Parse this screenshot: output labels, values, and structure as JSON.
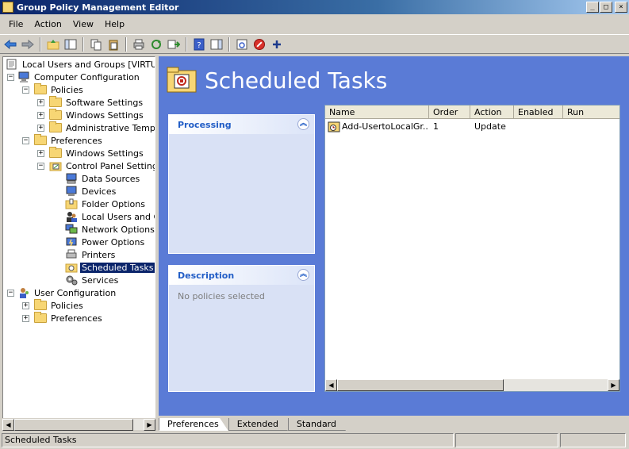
{
  "window": {
    "title": "Group Policy Management Editor"
  },
  "menu": {
    "items": [
      "File",
      "Action",
      "View",
      "Help"
    ]
  },
  "tree": {
    "root": "Local Users and Groups [VIRTUALA",
    "computer_config": "Computer Configuration",
    "policies": "Policies",
    "software_settings": "Software Settings",
    "windows_settings": "Windows Settings",
    "admin_templates": "Administrative Templat",
    "preferences": "Preferences",
    "pref_windows_settings": "Windows Settings",
    "control_panel_settings": "Control Panel Settings",
    "data_sources": "Data Sources",
    "devices": "Devices",
    "folder_options": "Folder Options",
    "local_users": "Local Users and Gr",
    "network_options": "Network Options",
    "power_options": "Power Options",
    "printers": "Printers",
    "scheduled_tasks": "Scheduled Tasks",
    "services": "Services",
    "user_config": "User Configuration",
    "user_policies": "Policies",
    "user_preferences": "Preferences"
  },
  "header": {
    "title": "Scheduled Tasks"
  },
  "processing_panel": {
    "title": "Processing"
  },
  "description_panel": {
    "title": "Description",
    "text": "No policies selected"
  },
  "list": {
    "columns": [
      "Name",
      "Order",
      "Action",
      "Enabled",
      "Run"
    ],
    "rows": [
      {
        "name": "Add-UsertoLocalGr...",
        "order": "1",
        "action": "Update",
        "enabled": "",
        "run": ""
      }
    ]
  },
  "tabs": [
    "Preferences",
    "Extended",
    "Standard"
  ],
  "status": {
    "text": "Scheduled Tasks"
  }
}
